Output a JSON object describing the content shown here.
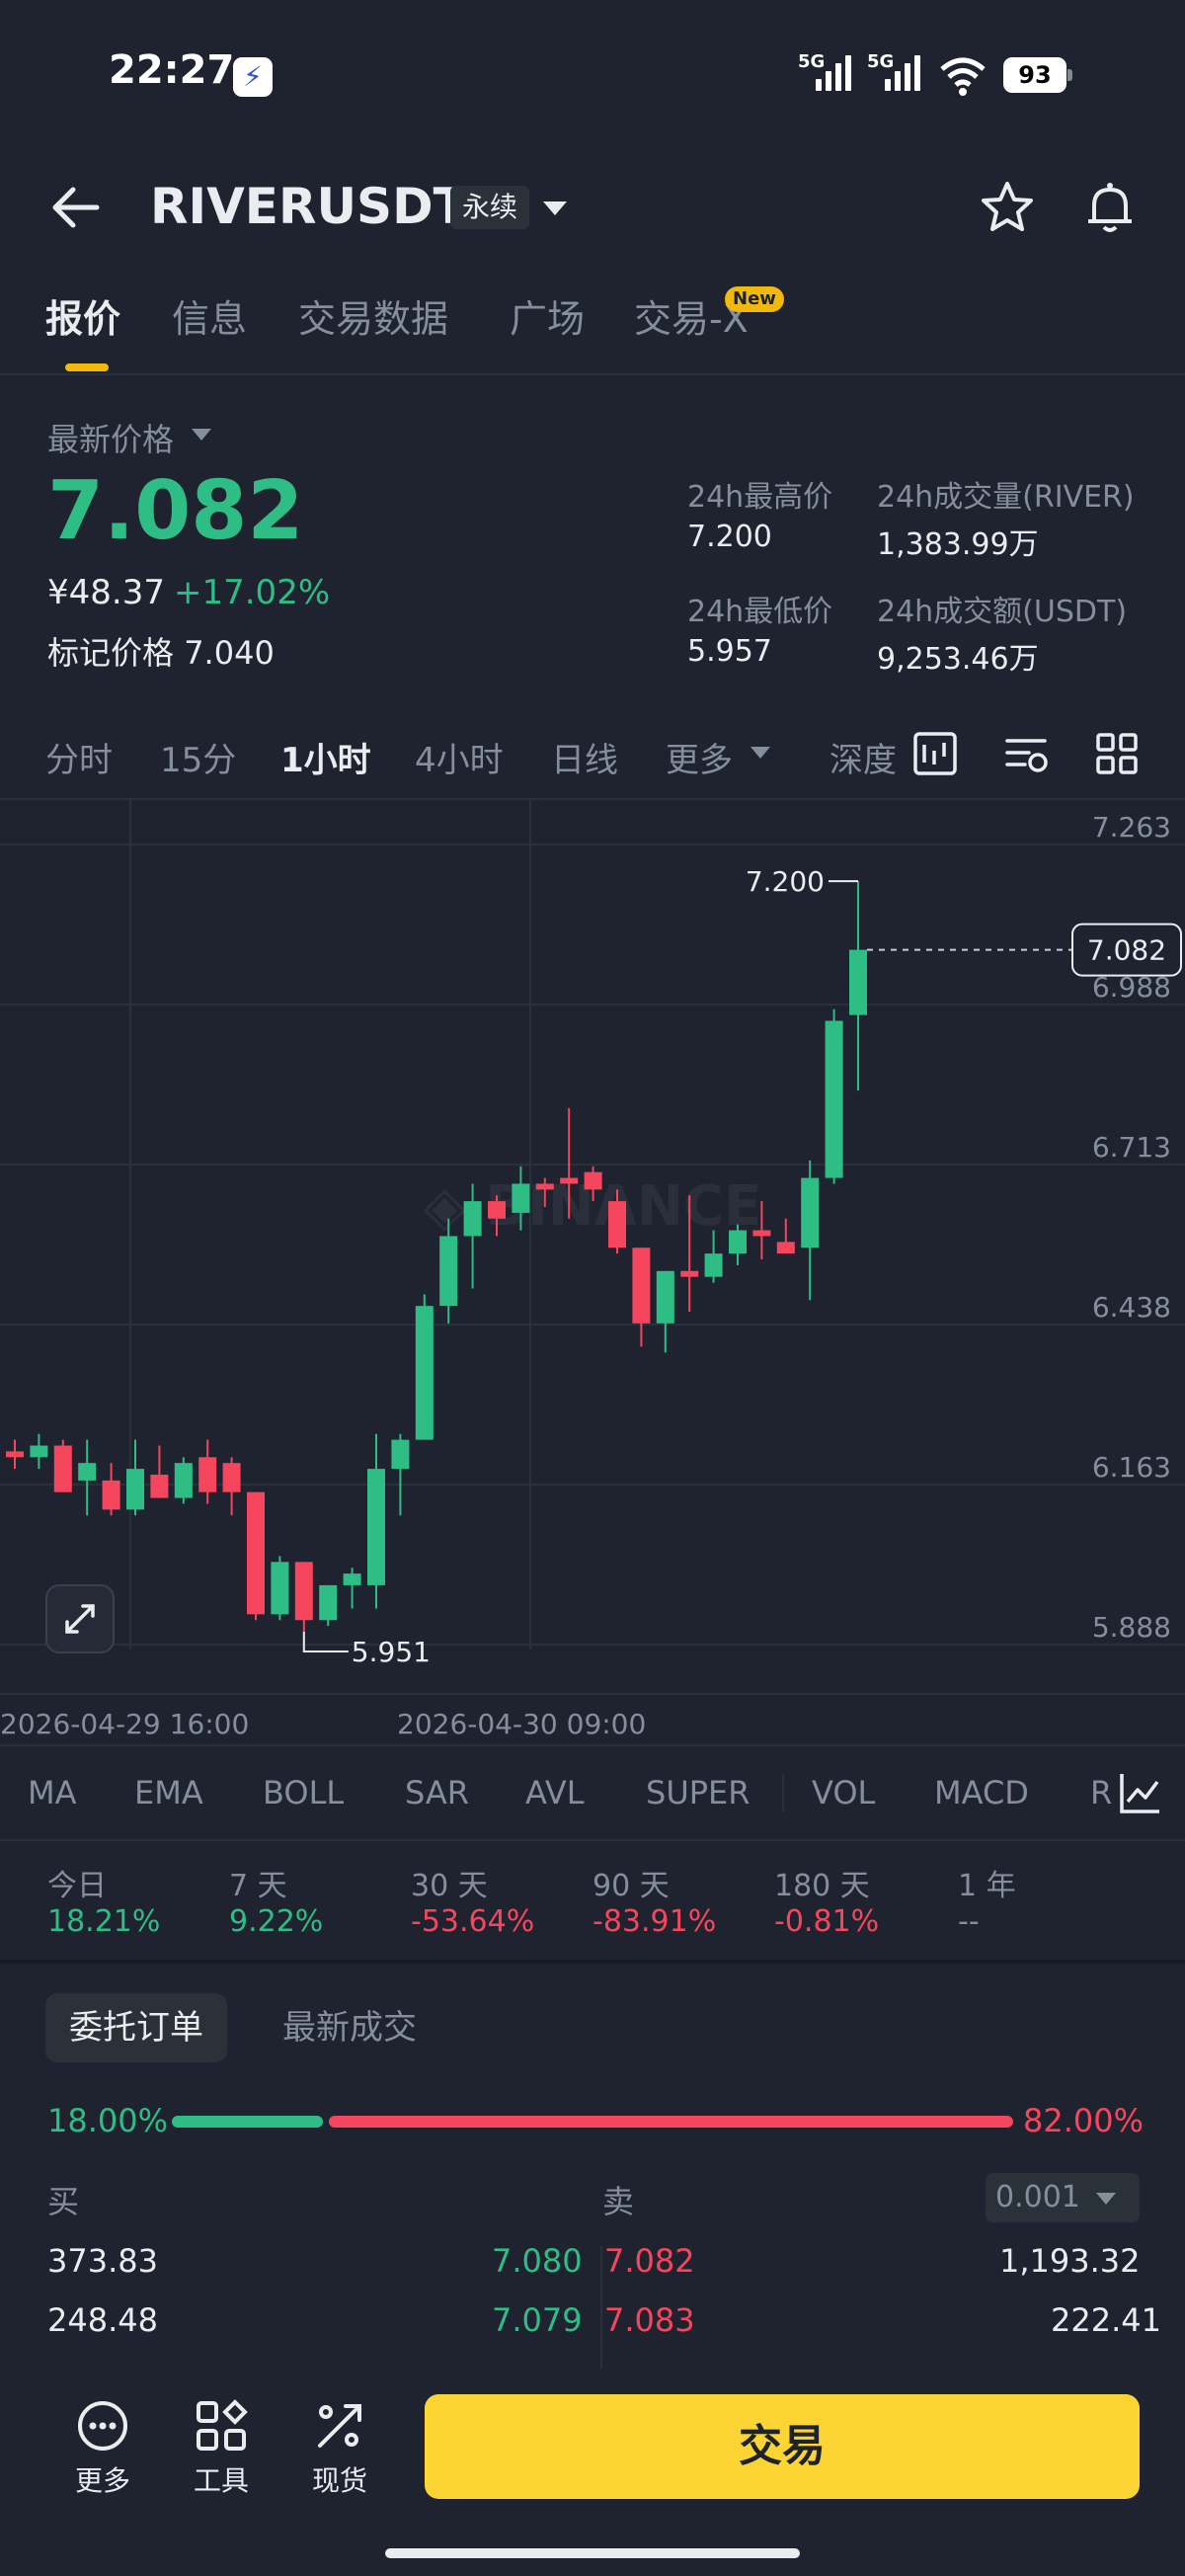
{
  "status_bar": {
    "time": "22:27",
    "network1": "5G",
    "network2": "5G",
    "battery": "93"
  },
  "header": {
    "symbol": "RIVERUSDT",
    "contract_type": "永续"
  },
  "tabs": [
    {
      "label": "报价",
      "active": true
    },
    {
      "label": "信息"
    },
    {
      "label": "交易数据"
    },
    {
      "label": "广场"
    },
    {
      "label": "交易-X",
      "badge": "New"
    }
  ],
  "price": {
    "latest_label": "最新价格",
    "last": "7.082",
    "cny": "¥48.37",
    "change_pct": "+17.02%",
    "mark_label": "标记价格",
    "mark": "7.040"
  },
  "stats": {
    "high_label": "24h最高价",
    "high": "7.200",
    "vol_label": "24h成交量(RIVER)",
    "vol": "1,383.99万",
    "low_label": "24h最低价",
    "low": "5.957",
    "amt_label": "24h成交额(USDT)",
    "amt": "9,253.46万"
  },
  "intervals": [
    "分时",
    "15分",
    "1小时",
    "4小时",
    "日线",
    "更多",
    "深度"
  ],
  "active_interval": "1小时",
  "chart_data": {
    "type": "candlestick",
    "interval": "1小时",
    "y_axis_ticks": [
      "7.263",
      "6.988",
      "6.713",
      "6.438",
      "6.163",
      "5.888"
    ],
    "x_axis_labels": [
      "2026-04-29 16:00",
      "2026-04-30 09:00"
    ],
    "last_price_label": "7.082",
    "max_label": "7.200",
    "min_label": "5.951",
    "candles": [
      {
        "o": 6.22,
        "h": 6.24,
        "l": 6.19,
        "c": 6.21
      },
      {
        "o": 6.21,
        "h": 6.25,
        "l": 6.19,
        "c": 6.23
      },
      {
        "o": 6.23,
        "h": 6.24,
        "l": 6.15,
        "c": 6.15
      },
      {
        "o": 6.17,
        "h": 6.24,
        "l": 6.11,
        "c": 6.2
      },
      {
        "o": 6.17,
        "h": 6.2,
        "l": 6.11,
        "c": 6.12
      },
      {
        "o": 6.12,
        "h": 6.24,
        "l": 6.11,
        "c": 6.19
      },
      {
        "o": 6.18,
        "h": 6.23,
        "l": 6.14,
        "c": 6.14
      },
      {
        "o": 6.14,
        "h": 6.21,
        "l": 6.13,
        "c": 6.2
      },
      {
        "o": 6.21,
        "h": 6.24,
        "l": 6.13,
        "c": 6.15
      },
      {
        "o": 6.2,
        "h": 6.21,
        "l": 6.11,
        "c": 6.15
      },
      {
        "o": 6.15,
        "h": 6.15,
        "l": 5.93,
        "c": 5.94
      },
      {
        "o": 5.94,
        "h": 6.04,
        "l": 5.93,
        "c": 6.03
      },
      {
        "o": 6.03,
        "h": 6.03,
        "l": 5.91,
        "c": 5.93
      },
      {
        "o": 5.93,
        "h": 5.99,
        "l": 5.92,
        "c": 5.99
      },
      {
        "o": 5.99,
        "h": 6.02,
        "l": 5.95,
        "c": 6.01
      },
      {
        "o": 5.99,
        "h": 6.25,
        "l": 5.95,
        "c": 6.19
      },
      {
        "o": 6.19,
        "h": 6.25,
        "l": 6.11,
        "c": 6.24
      },
      {
        "o": 6.24,
        "h": 6.49,
        "l": 6.24,
        "c": 6.47
      },
      {
        "o": 6.47,
        "h": 6.62,
        "l": 6.44,
        "c": 6.59
      },
      {
        "o": 6.59,
        "h": 6.68,
        "l": 6.5,
        "c": 6.65
      },
      {
        "o": 6.65,
        "h": 6.66,
        "l": 6.59,
        "c": 6.62
      },
      {
        "o": 6.63,
        "h": 6.71,
        "l": 6.6,
        "c": 6.68
      },
      {
        "o": 6.68,
        "h": 6.69,
        "l": 6.64,
        "c": 6.67
      },
      {
        "o": 6.69,
        "h": 6.81,
        "l": 6.62,
        "c": 6.68
      },
      {
        "o": 6.7,
        "h": 6.71,
        "l": 6.65,
        "c": 6.67
      },
      {
        "o": 6.65,
        "h": 6.67,
        "l": 6.56,
        "c": 6.57
      },
      {
        "o": 6.57,
        "h": 6.57,
        "l": 6.4,
        "c": 6.44
      },
      {
        "o": 6.44,
        "h": 6.51,
        "l": 6.39,
        "c": 6.53
      },
      {
        "o": 6.53,
        "h": 6.66,
        "l": 6.46,
        "c": 6.52
      },
      {
        "o": 6.52,
        "h": 6.6,
        "l": 6.51,
        "c": 6.56
      },
      {
        "o": 6.56,
        "h": 6.61,
        "l": 6.54,
        "c": 6.6
      },
      {
        "o": 6.6,
        "h": 6.65,
        "l": 6.55,
        "c": 6.59
      },
      {
        "o": 6.58,
        "h": 6.62,
        "l": 6.57,
        "c": 6.56
      },
      {
        "o": 6.57,
        "h": 6.72,
        "l": 6.48,
        "c": 6.69
      },
      {
        "o": 6.69,
        "h": 6.98,
        "l": 6.68,
        "c": 6.96
      },
      {
        "o": 6.97,
        "h": 7.2,
        "l": 6.84,
        "c": 7.082
      }
    ]
  },
  "indicators": [
    "MA",
    "EMA",
    "BOLL",
    "SAR",
    "AVL",
    "SUPER",
    "VOL",
    "MACD",
    "R"
  ],
  "performance": [
    {
      "label": "今日",
      "value": "18.21%",
      "dir": "up"
    },
    {
      "label": "7 天",
      "value": "9.22%",
      "dir": "up"
    },
    {
      "label": "30 天",
      "value": "-53.64%",
      "dir": "down"
    },
    {
      "label": "90 天",
      "value": "-83.91%",
      "dir": "down"
    },
    {
      "label": "180 天",
      "value": "-0.81%",
      "dir": "down"
    },
    {
      "label": "1 年",
      "value": "--",
      "dir": "none"
    }
  ],
  "order_tabs": {
    "orders": "委托订单",
    "trades": "最新成交"
  },
  "ratio": {
    "buy": "18.00%",
    "sell": "82.00%",
    "buy_fraction": 0.18
  },
  "orderbook": {
    "buy_label": "买",
    "sell_label": "卖",
    "precision": "0.001",
    "rows": [
      {
        "bid_qty": "373.83",
        "bid": "7.080",
        "ask": "7.082",
        "ask_qty": "1,193.32"
      },
      {
        "bid_qty": "248.48",
        "bid": "7.079",
        "ask": "7.083",
        "ask_qty": "222.41"
      }
    ]
  },
  "bottom": {
    "more": "更多",
    "tools": "工具",
    "spot": "现货",
    "trade": "交易"
  },
  "colors": {
    "up": "#2ebd85",
    "down": "#f6465d",
    "accent": "#f0b90b",
    "trade_button": "#fcd535"
  }
}
